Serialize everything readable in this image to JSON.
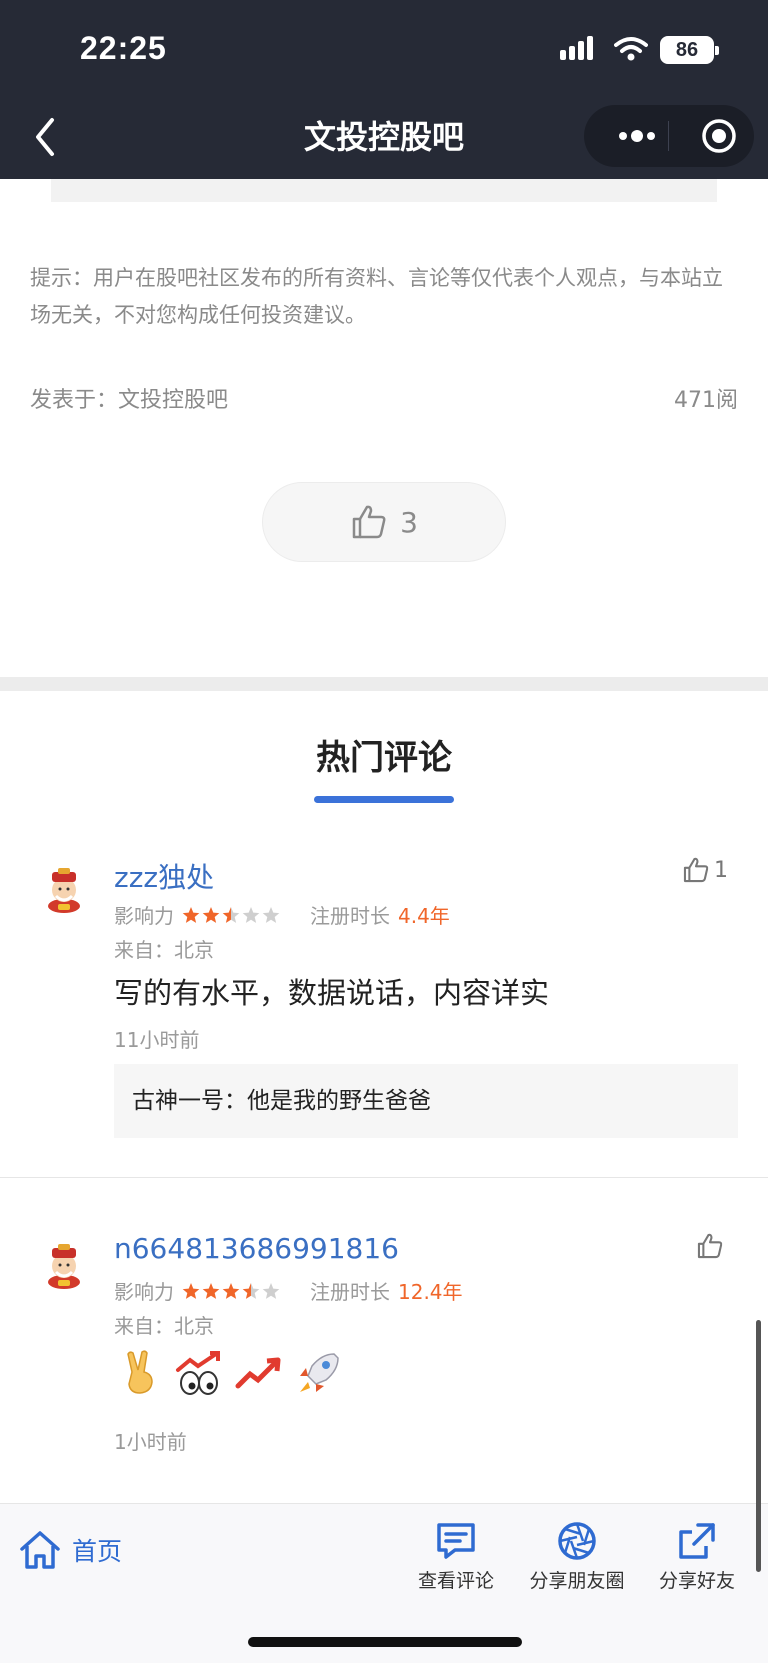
{
  "status_bar": {
    "time": "22:25",
    "battery": "86"
  },
  "nav": {
    "title": "文投控股吧"
  },
  "article": {
    "tip": "提示：用户在股吧社区发布的所有资料、言论等仅代表个人观点，与本站立场无关，不对您构成任何投资建议。",
    "posted_label": "发表于：",
    "posted_board": "文投控股吧",
    "reads": "471阅",
    "likes": "3"
  },
  "hot_comments": {
    "title": "热门评论",
    "items": [
      {
        "username": "zzz独处",
        "likes": "1",
        "influence_label": "影响力",
        "influence_stars": 2.5,
        "reg_label": "注册时长",
        "reg_value": "4.4年",
        "from": "来自：北京",
        "text": "写的有水平，数据说话，内容详实",
        "time": "11小时前",
        "reply": "古神一号：他是我的野生爸爸"
      },
      {
        "username": "n664813686991816",
        "likes": "",
        "influence_label": "影响力",
        "influence_stars": 3.5,
        "reg_label": "注册时长",
        "reg_value": "12.4年",
        "from": "来自：北京",
        "emojis": [
          "victory-hand-icon",
          "chart-up-eyes-icon",
          "chart-up-icon",
          "rocket-icon"
        ],
        "time": "1小时前"
      }
    ]
  },
  "bottom_bar": {
    "home": "首页",
    "view_comments": "查看评论",
    "share_moments": "分享朋友圈",
    "share_friends": "分享好友"
  },
  "colors": {
    "accent": "#3b72d9",
    "link": "#3a6fc2",
    "orange": "#f0662a",
    "nav_bg": "#262a36"
  }
}
